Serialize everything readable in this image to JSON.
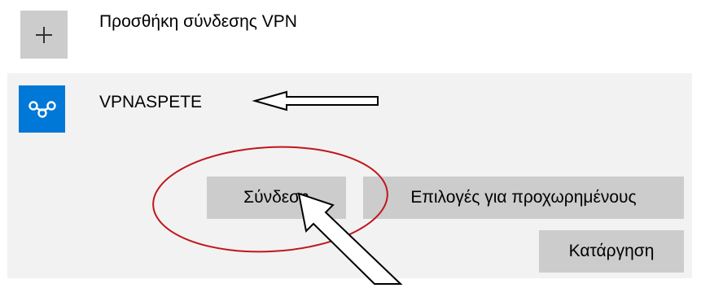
{
  "add_vpn": {
    "icon": "plus-icon",
    "label": "Προσθήκη σύνδεσης VPN"
  },
  "vpn_connection": {
    "icon": "vpn-link-icon",
    "name": "VPNASPETE",
    "accent_color": "#0078d7",
    "buttons": {
      "connect": "Σύνδεση",
      "advanced": "Επιλογές για προχωρημένους",
      "remove": "Κατάργηση"
    }
  },
  "annotations": {
    "ellipse_color": "#c0161c",
    "arrow_color": "#000000"
  }
}
